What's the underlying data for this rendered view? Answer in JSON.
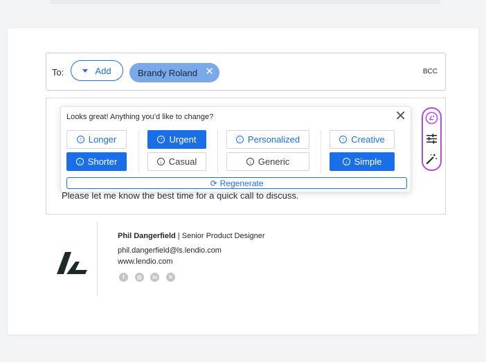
{
  "compose": {
    "to_label": "To:",
    "add_label": "Add",
    "recipient_chip": "Brandy Roland",
    "bcc_label": "BCC",
    "body_text": "Please let me know the best time for a quick call to discuss."
  },
  "ai_popup": {
    "title": "Looks great! Anything you’d like to change?",
    "options": {
      "longer": "Longer",
      "shorter": "Shorter",
      "urgent": "Urgent",
      "casual": "Casual",
      "personalized": "Personalized",
      "generic": "Generic",
      "creative": "Creative",
      "simple": "Simple"
    },
    "regenerate_label": "Regenerate",
    "selected": [
      "Shorter",
      "Urgent",
      "Simple"
    ]
  },
  "side_toolbar": {
    "icons": [
      "ai-compose-icon",
      "sliders-icon",
      "magic-wand-icon"
    ]
  },
  "signature": {
    "name": "Phil Dangerfield",
    "separator": " | ",
    "role": "Senior Product Designer",
    "email": "phil.dangerfield@ls.lendio.com",
    "website": "www.lendio.com",
    "social_icons": [
      "facebook-icon",
      "instagram-icon",
      "linkedin-icon",
      "x-icon"
    ]
  },
  "colors": {
    "accent_blue": "#1a6fe8",
    "chip_blue": "#7aa9ea",
    "ai_purple": "#b04be0"
  }
}
